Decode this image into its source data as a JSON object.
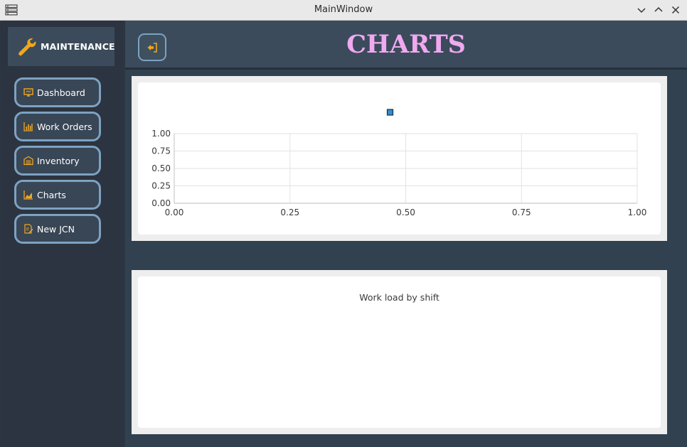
{
  "window": {
    "title": "MainWindow"
  },
  "sidebar": {
    "brand": "MAINTENANCE",
    "items": [
      {
        "label": "Dashboard",
        "icon": "monitor-icon"
      },
      {
        "label": "Work Orders",
        "icon": "bar-chart-icon"
      },
      {
        "label": "Inventory",
        "icon": "warehouse-icon"
      },
      {
        "label": "Charts",
        "icon": "area-chart-icon"
      },
      {
        "label": "New JCN",
        "icon": "edit-document-icon"
      }
    ]
  },
  "header": {
    "title": "CHARTS"
  },
  "colors": {
    "accent_icon": "#f2a71b",
    "title": "#f0a9f0",
    "button_border": "#7ea2c1"
  },
  "chart_data": [
    {
      "type": "scatter",
      "title": "",
      "xlabel": "",
      "ylabel": "",
      "xlim": [
        0,
        1
      ],
      "ylim": [
        0,
        1
      ],
      "x_ticks": [
        "0.00",
        "0.25",
        "0.50",
        "0.75",
        "1.00"
      ],
      "y_ticks": [
        "0.00",
        "0.25",
        "0.50",
        "0.75",
        "1.00"
      ],
      "legend": [
        "square-marker"
      ],
      "legend_position": "top",
      "series": [],
      "grid": true
    },
    {
      "type": "bar",
      "title": "Work load by shift",
      "series": []
    }
  ]
}
